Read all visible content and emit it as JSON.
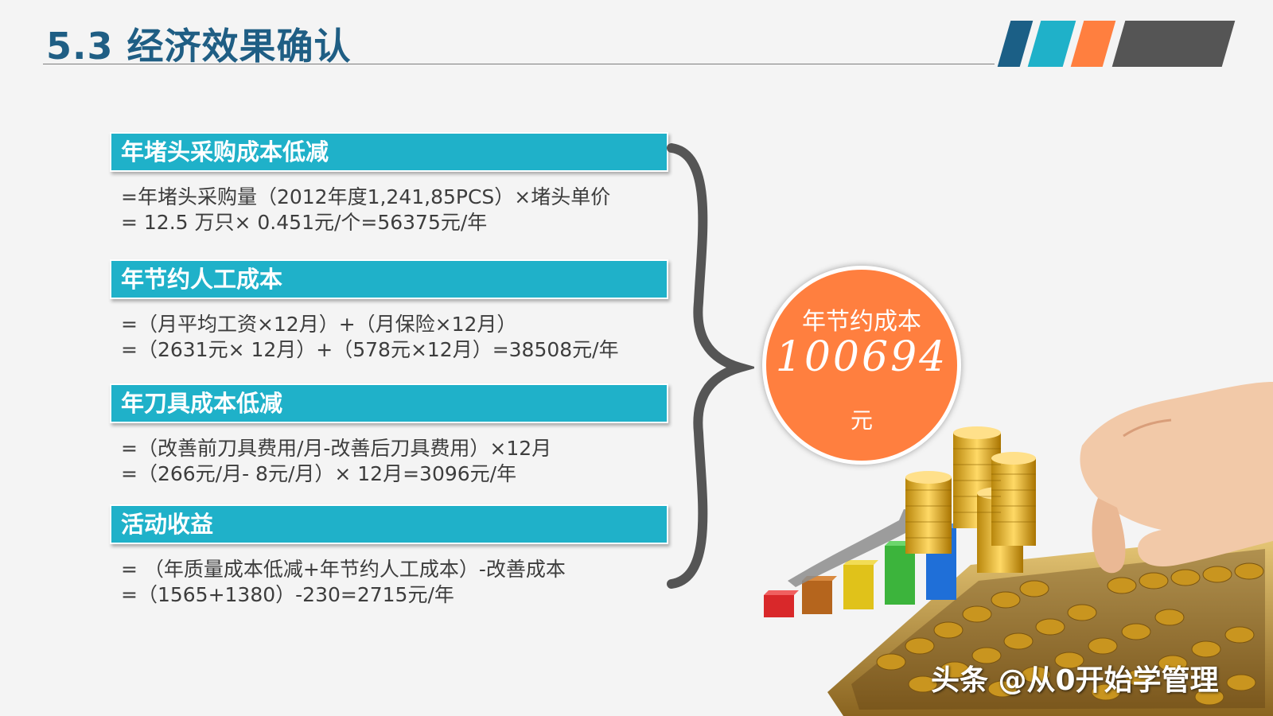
{
  "header": {
    "title": "5.3 经济效果确认",
    "stripe_colors": [
      "#1b5f86",
      "#1fb1c9",
      "#ff7f3f",
      "#555555"
    ]
  },
  "sections": [
    {
      "heading": "年堵头采购成本低减",
      "lines": [
        "=年堵头采购量（2012年度1,241,85PCS）×堵头单价",
        "= 12.5 万只× 0.451元/个=56375元/年"
      ]
    },
    {
      "heading": "年节约人工成本",
      "lines": [
        "=（月平均工资×12月）+（月保险×12月）",
        "=（2631元× 12月）+（578元×12月）=38508元/年"
      ]
    },
    {
      "heading": "年刀具成本低减",
      "lines": [
        "=（改善前刀具费用/月-改善后刀具费用）×12月",
        "=（266元/月- 8元/月）× 12月=3096元/年"
      ]
    },
    {
      "heading": "活动收益",
      "lines": [
        "= （年质量成本低减+年节约人工成本）-改善成本",
        "=（1565+1380）-230=2715元/年"
      ]
    }
  ],
  "summary": {
    "label": "年节约成本",
    "value": "100694",
    "unit": "元",
    "color": "#ff7f3f"
  },
  "illustration": {
    "icons": [
      "coin-stack-icon",
      "bar-chart-icon",
      "growth-arrow-icon",
      "abacus-icon",
      "hand-icon"
    ],
    "bar_colors": [
      "#d9282a",
      "#b5651d",
      "#e0c21a",
      "#3cb43c",
      "#1f6fd8"
    ]
  },
  "watermark": "头条 @从0开始学管理"
}
